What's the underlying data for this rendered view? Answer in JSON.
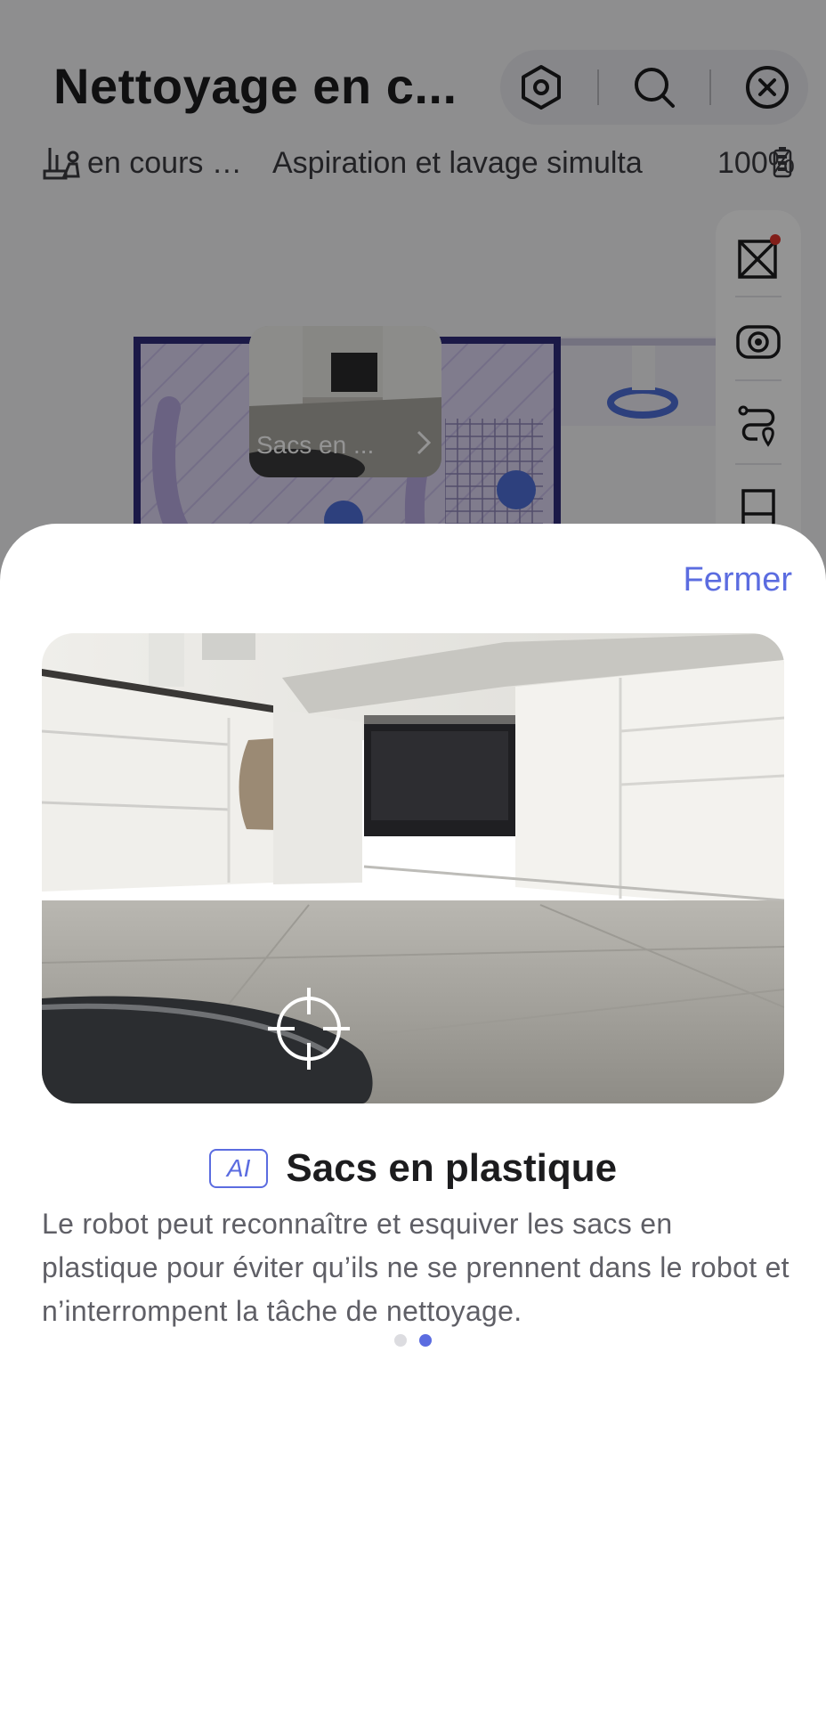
{
  "header": {
    "title": "Nettoyage en c...",
    "actions": [
      {
        "icon": "hexagon-settings-icon"
      },
      {
        "icon": "search-icon"
      },
      {
        "icon": "close-circle-icon"
      }
    ]
  },
  "status": {
    "task_state": "… en cours",
    "mode": "Aspiration et lavage simulta",
    "battery": "100%"
  },
  "map": {
    "thumbnail_label": "Sacs en ..."
  },
  "sheet": {
    "close_label": "Fermer",
    "badge": "AI",
    "feature_title": "Sacs en plastique",
    "description": "Le robot peut reconnaître et esquiver les sacs en plastique pour éviter qu’ils ne se prennent dans le robot et n’interrompent la tâche de nettoyage.",
    "pagination": {
      "total": 2,
      "current": 2
    }
  },
  "colors": {
    "accent": "#5b6ce0",
    "map_purple": "#b7a9e0"
  }
}
